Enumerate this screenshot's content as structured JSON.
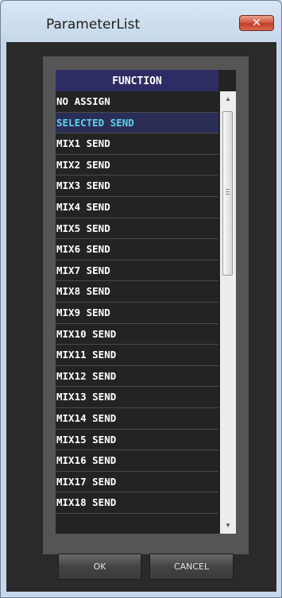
{
  "window": {
    "title": "ParameterList",
    "close_label": "✕"
  },
  "list": {
    "header": "FUNCTION",
    "items": [
      {
        "label": "NO ASSIGN"
      },
      {
        "label": "SELECTED SEND",
        "selected": true
      },
      {
        "label": "MIX1 SEND"
      },
      {
        "label": "MIX2 SEND"
      },
      {
        "label": "MIX3 SEND"
      },
      {
        "label": "MIX4 SEND"
      },
      {
        "label": "MIX5 SEND"
      },
      {
        "label": "MIX6 SEND"
      },
      {
        "label": "MIX7 SEND"
      },
      {
        "label": "MIX8 SEND"
      },
      {
        "label": "MIX9 SEND"
      },
      {
        "label": "MIX10 SEND"
      },
      {
        "label": "MIX11 SEND"
      },
      {
        "label": "MIX12 SEND"
      },
      {
        "label": "MIX13 SEND"
      },
      {
        "label": "MIX14 SEND"
      },
      {
        "label": "MIX15 SEND"
      },
      {
        "label": "MIX16 SEND"
      },
      {
        "label": "MIX17 SEND"
      },
      {
        "label": "MIX18 SEND"
      }
    ]
  },
  "buttons": {
    "ok": "OK",
    "cancel": "CANCEL"
  },
  "colors": {
    "header_bg": "#2d2c64",
    "selected_bg": "#2a2e56",
    "selected_text": "#5ed3ec",
    "list_bg": "#232323",
    "close_button": "#c23b28"
  }
}
